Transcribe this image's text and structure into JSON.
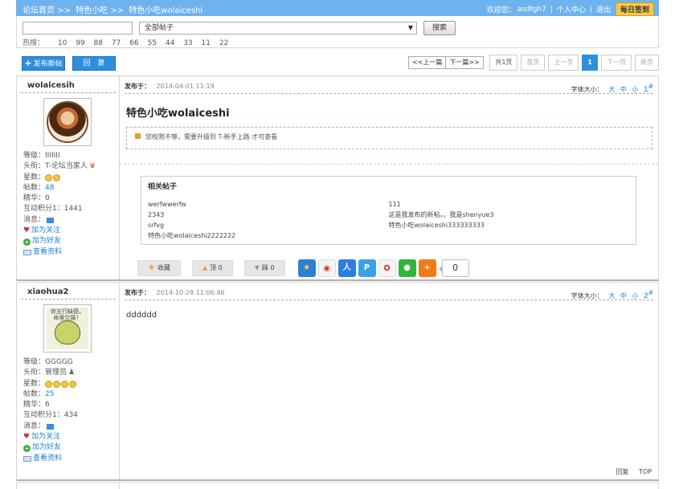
{
  "topbar": {
    "crumbs": [
      "论坛首页",
      ">>",
      "特色小吃",
      ">>",
      "特色小吃wolaiceshi"
    ],
    "welcome": "欢迎您：",
    "username": "asdfgh7",
    "user_center": "个人中心",
    "logout": "退出",
    "daily_signin": "每日签到"
  },
  "search": {
    "keyword_value": "",
    "select_value": "全部帖子",
    "button": "搜索",
    "hot_label": "热搜：",
    "hot_terms": [
      "10",
      "99",
      "88",
      "77",
      "66",
      "55",
      "44",
      "33",
      "11",
      "22"
    ]
  },
  "toolbar": {
    "new_post": "发布新帖",
    "reply": "回　复",
    "prev_thread": "<<上一篇",
    "next_thread": "下一篇>>",
    "pager": {
      "total": "共1页",
      "first": "首页",
      "prev": "上一页",
      "current": "1",
      "next": "下一页",
      "last": "尾页"
    }
  },
  "posts": [
    {
      "author": "wolaicesih",
      "level_label": "等级：",
      "level_value": "IIIIIII",
      "title_label": "头衔：",
      "title_value": "T-论坛当家人",
      "stars_label": "星数：",
      "stars_count": 2,
      "posts_label": "帖数：",
      "posts_value": "48",
      "essence_label": "精华：",
      "essence_value": "0",
      "points_label": "互动积分1：",
      "points_value": "1441",
      "message_label": "消息：",
      "follow": "加为关注",
      "add_friend": "加为好友",
      "view_profile": "查看资料",
      "posted_label": "发布于：",
      "posted_date": "2014-04-01 11:19",
      "fontsize_label": "字体大小：",
      "fs_large": "大",
      "fs_medium": "中",
      "fs_small": "小",
      "floor": "1",
      "floor_mark": "#",
      "post_title": "特色小吃wolaiceshi",
      "notice": "您权限不够，需要升级到 T-新手上路 才可查看",
      "related_title": "相关帖子",
      "related_left": [
        "werfwwerfw",
        "2343",
        "srfvg",
        "特色小吃wolaiceshi2222222"
      ],
      "related_right": [
        "111",
        "这是我发布的新帖。。我是shenyue3",
        "特色小吃wolaiceshi333333333"
      ],
      "collect": "收藏",
      "up_label": "顶",
      "up_count": "0",
      "down_label": "踩",
      "down_count": "0",
      "share_count": "0"
    },
    {
      "author": "xiaohua2",
      "avatar_text": "你五行缺德，命里欠揍！",
      "level_label": "等级：",
      "level_value": "GGGGG",
      "title_label": "头衔：",
      "title_value": "管理员",
      "stars_label": "星数：",
      "stars_count": 4,
      "posts_label": "帖数：",
      "posts_value": "25",
      "essence_label": "精华：",
      "essence_value": "6",
      "points_label": "互动积分1：",
      "points_value": "434",
      "message_label": "消息：",
      "follow": "加为关注",
      "add_friend": "加为好友",
      "view_profile": "查看资料",
      "posted_label": "发布于：",
      "posted_date": "2014-10-28 11:06:46",
      "fontsize_label": "字体大小：",
      "fs_large": "大",
      "fs_medium": "中",
      "fs_small": "小",
      "floor": "2",
      "floor_mark": "#",
      "body": "dddddd",
      "reply": "回复",
      "top": "TOP"
    }
  ],
  "colors": {
    "topbar_bg": "#6fb3ee",
    "accent_blue": "#2e8fdc",
    "signin_yellow": "#f7c94b"
  }
}
